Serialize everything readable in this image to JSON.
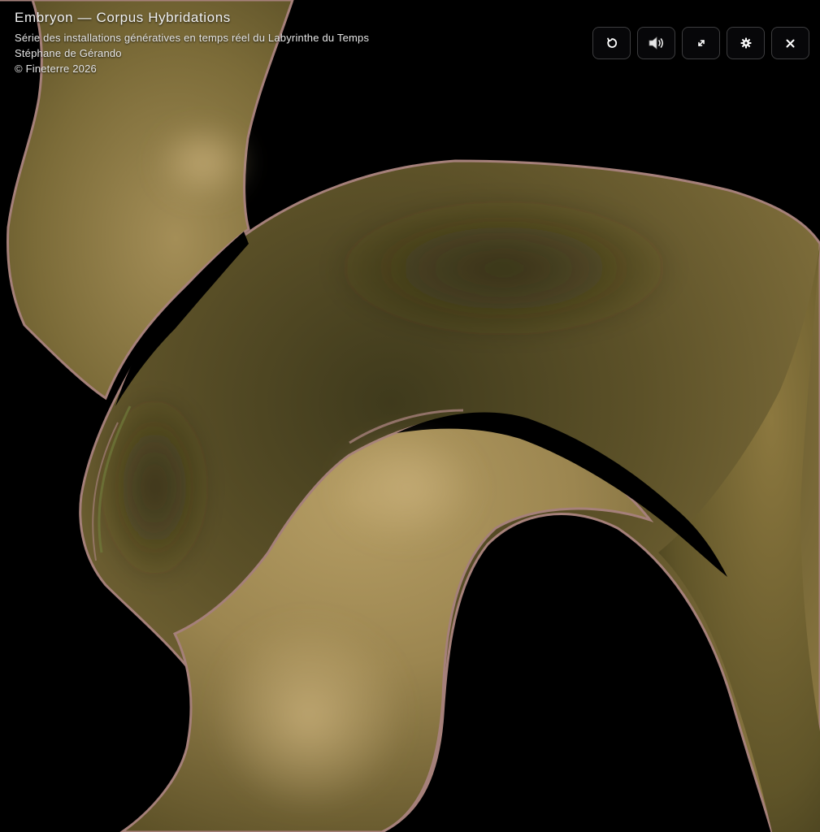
{
  "header": {
    "title": "Embryon — Corpus Hybridations",
    "series_line": "Série des installations génératives en temps réel du Labyrinthe du Temps",
    "author": "Stéphane de Gérando",
    "copyright": "© Fineterre 2026"
  },
  "controls": {
    "reset_icon": "refresh-icon",
    "sound_icon": "speaker-icon",
    "fullscreen_icon": "expand-icon",
    "settings_icon": "gear-icon",
    "close_icon": "close-icon"
  },
  "colors": {
    "background": "#000000",
    "form_dark": "#4d4521",
    "form_mid": "#7a6a37",
    "form_light": "#b39a62",
    "edge_pink": "#a5807a",
    "edge_green": "#6f7a3a"
  }
}
